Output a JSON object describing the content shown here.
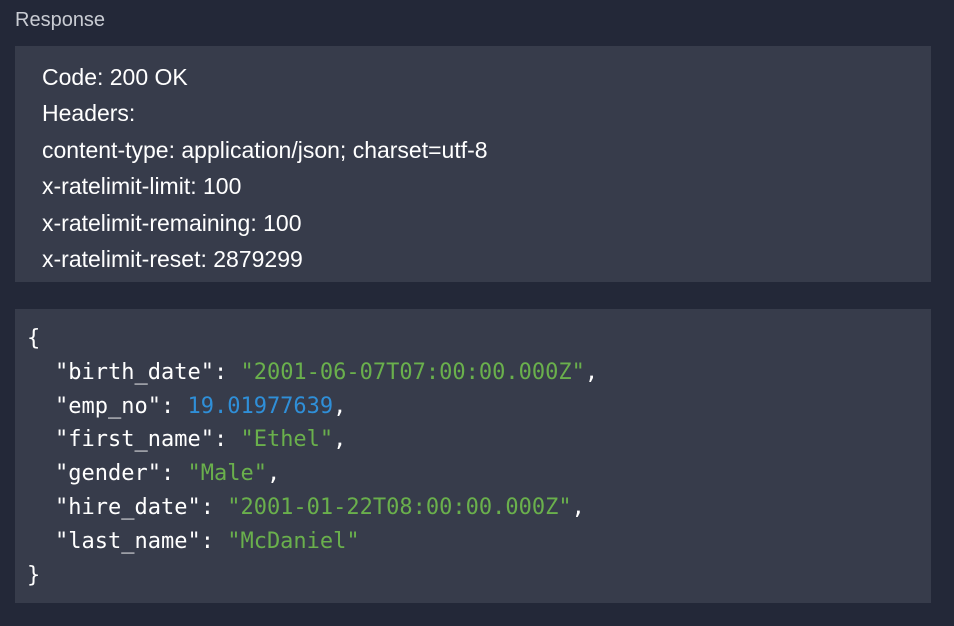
{
  "section_title": "Response",
  "code_line": "Code: 200 OK",
  "headers_label": "Headers:",
  "headers": [
    "content-type: application/json; charset=utf-8",
    "x-ratelimit-limit: 100",
    "x-ratelimit-remaining: 100",
    "x-ratelimit-reset: 2879299"
  ],
  "json_open": "{",
  "json_close": "}",
  "json_fields": [
    {
      "key": "\"birth_date\"",
      "value": "\"2001-06-07T07:00:00.000Z\"",
      "type": "string",
      "comma": ","
    },
    {
      "key": "\"emp_no\"",
      "value": "19.01977639",
      "type": "number",
      "comma": ","
    },
    {
      "key": "\"first_name\"",
      "value": "\"Ethel\"",
      "type": "string",
      "comma": ","
    },
    {
      "key": "\"gender\"",
      "value": "\"Male\"",
      "type": "string",
      "comma": ","
    },
    {
      "key": "\"hire_date\"",
      "value": "\"2001-01-22T08:00:00.000Z\"",
      "type": "string",
      "comma": ","
    },
    {
      "key": "\"last_name\"",
      "value": "\"McDaniel\"",
      "type": "string",
      "comma": ""
    }
  ],
  "colors": {
    "background": "#232838",
    "panel": "#373c4b",
    "string": "#6ab04c",
    "number": "#2f8fd8",
    "text": "#ffffff",
    "title": "#c9ccd3"
  }
}
